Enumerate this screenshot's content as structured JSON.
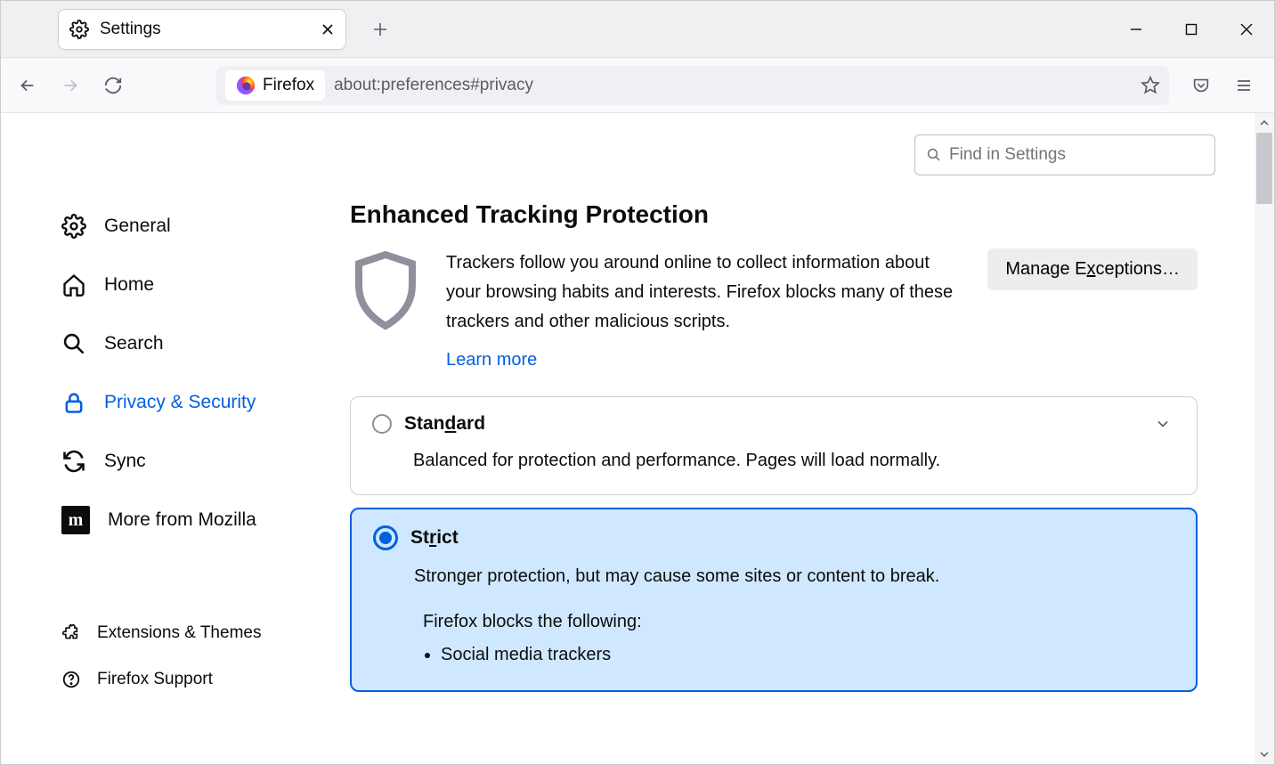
{
  "tab": {
    "label": "Settings"
  },
  "url": {
    "identity": "Firefox",
    "value": "about:preferences#privacy"
  },
  "search": {
    "placeholder": "Find in Settings"
  },
  "sidebar": {
    "general": "General",
    "home": "Home",
    "search": "Search",
    "privacy": "Privacy & Security",
    "sync": "Sync",
    "more": "More from Mozilla",
    "extensions": "Extensions & Themes",
    "support": "Firefox Support"
  },
  "etp": {
    "title": "Enhanced Tracking Protection",
    "desc": "Trackers follow you around online to collect information about your browsing habits and interests. Firefox blocks many of these trackers and other malicious scripts.",
    "learn": "Learn more",
    "manage_pre": "Manage E",
    "manage_ul": "x",
    "manage_post": "ceptions…"
  },
  "standard": {
    "label_pre": "Stan",
    "label_ul": "d",
    "label_post": "ard",
    "desc": "Balanced for protection and performance. Pages will load normally."
  },
  "strict": {
    "label_pre": "St",
    "label_ul": "r",
    "label_post": "ict",
    "desc": "Stronger protection, but may cause some sites or content to break.",
    "blocks_heading": "Firefox blocks the following:",
    "blocks": {
      "item1": "Social media trackers"
    }
  }
}
